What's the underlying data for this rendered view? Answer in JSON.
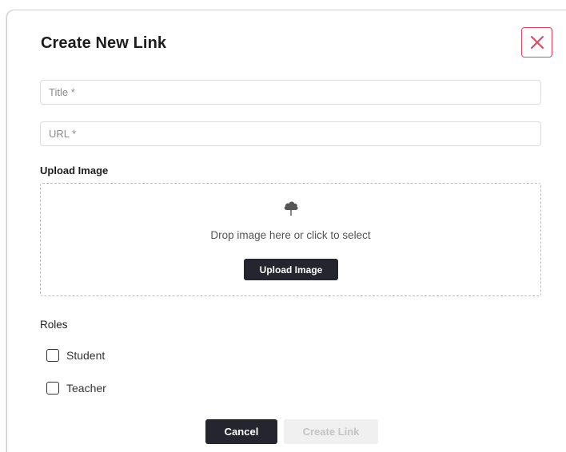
{
  "dialog": {
    "title": "Create New Link",
    "close_icon": "close-x-icon",
    "accent_color": "#e0455f"
  },
  "form": {
    "title_field": {
      "placeholder": "Title *",
      "value": ""
    },
    "url_field": {
      "placeholder": "URL *",
      "value": ""
    },
    "upload": {
      "section_label": "Upload Image",
      "icon": "cloud-upload-icon",
      "drop_text": "Drop image here or click to select",
      "button_label": "Upload Image"
    },
    "roles": {
      "label": "Roles",
      "options": [
        {
          "label": "Student",
          "checked": false
        },
        {
          "label": "Teacher",
          "checked": false
        }
      ]
    }
  },
  "actions": {
    "cancel_label": "Cancel",
    "create_label": "Create Link",
    "create_disabled": true,
    "primary_color": "#25252f"
  }
}
